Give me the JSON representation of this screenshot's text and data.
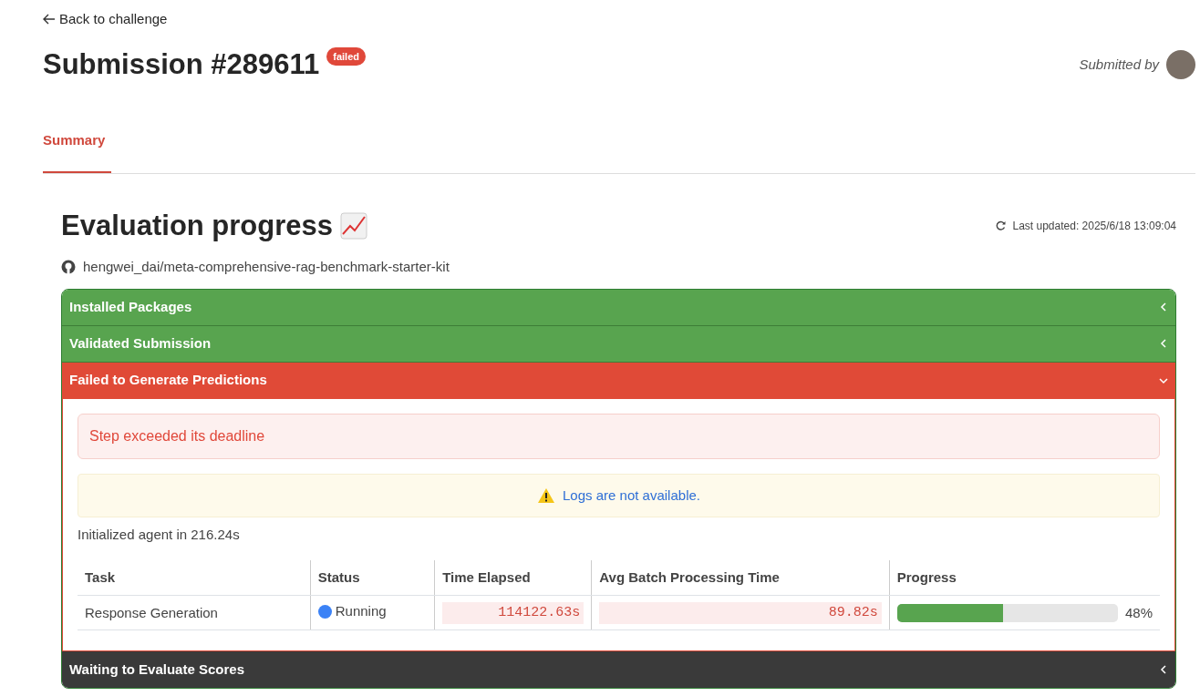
{
  "back_link": "Back to challenge",
  "title": "Submission #289611",
  "status_badge": "failed",
  "submitted_by": "Submitted by",
  "tabs": [
    {
      "label": "Summary",
      "selected": true
    }
  ],
  "evaluation": {
    "heading": "Evaluation progress",
    "last_updated": "Last updated: 2025/6/18 13:09:04",
    "repo": "hengwei_dai/meta-comprehensive-rag-benchmark-starter-kit",
    "steps": [
      {
        "label": "Installed Packages",
        "kind": "success",
        "expanded": false
      },
      {
        "label": "Validated Submission",
        "kind": "success",
        "expanded": false
      },
      {
        "label": "Failed to Generate Predictions",
        "kind": "failed",
        "expanded": true,
        "error": "Step exceeded its deadline",
        "warning": "Logs are not available.",
        "note": "Initialized agent in 216.24s",
        "table": {
          "columns": [
            "Task",
            "Status",
            "Time Elapsed",
            "Avg Batch Processing Time",
            "Progress"
          ],
          "rows": [
            {
              "task": "Response Generation",
              "status": "Running",
              "color": "#3b82f6",
              "time_elapsed": "114122.63s",
              "avg_batch": "89.82s",
              "level": 0.48,
              "percent": "48%"
            }
          ]
        }
      },
      {
        "label": "Waiting to Evaluate Scores",
        "kind": "pending",
        "expanded": false
      }
    ]
  }
}
